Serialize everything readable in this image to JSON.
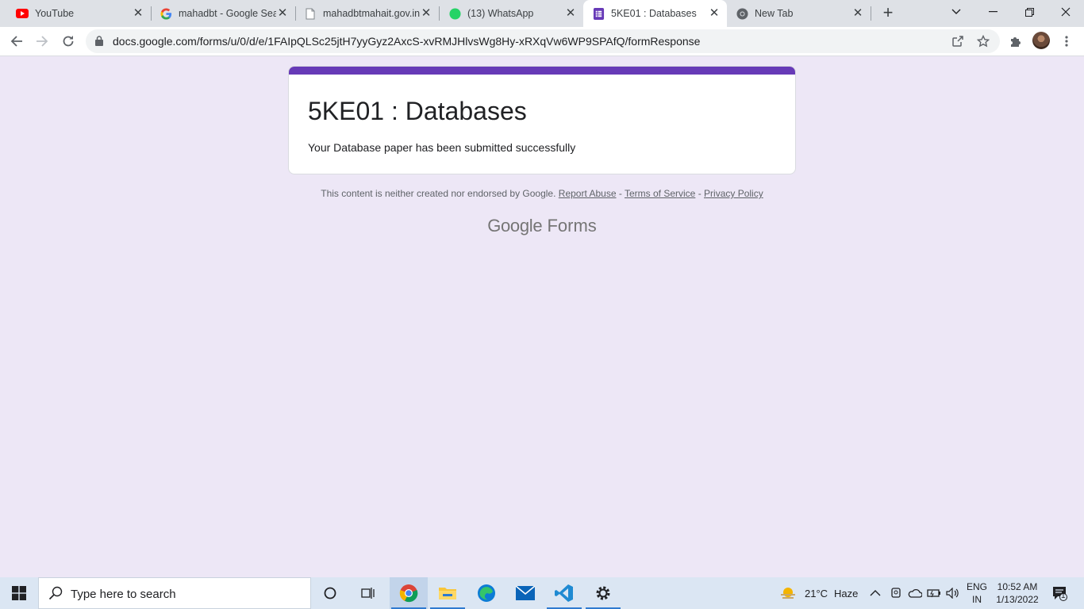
{
  "browser": {
    "tabs": [
      {
        "title": "YouTube",
        "icon": "youtube-icon",
        "active": false
      },
      {
        "title": "mahadbt - Google Sea",
        "icon": "google-icon",
        "active": false
      },
      {
        "title": "mahadbtmahait.gov.in",
        "icon": "document-icon",
        "active": false
      },
      {
        "title": "(13) WhatsApp",
        "icon": "whatsapp-icon",
        "badge": "13",
        "active": false
      },
      {
        "title": "5KE01 : Databases",
        "icon": "google-forms-icon",
        "active": true
      },
      {
        "title": "New Tab",
        "icon": "chrome-icon",
        "active": false
      }
    ],
    "url": "docs.google.com/forms/u/0/d/e/1FAIpQLSc25jtH7yyGyz2AxcS-xvRMJHlvsWg8Hy-xRXqVw6WP9SPAfQ/formResponse"
  },
  "form": {
    "title": "5KE01 : Databases",
    "message": "Your Database paper has been submitted successfully",
    "accent_color": "#673ab7"
  },
  "footer": {
    "disclaimer": "This content is neither created nor endorsed by Google.",
    "report_abuse": "Report Abuse",
    "separator": "-",
    "terms": "Terms of Service",
    "privacy": "Privacy Policy",
    "brand_google": "Google",
    "brand_forms": "Forms"
  },
  "taskbar": {
    "search_placeholder": "Type here to search",
    "weather": {
      "temp": "21°C",
      "condition": "Haze"
    },
    "language": {
      "line1": "ENG",
      "line2": "IN"
    },
    "clock": {
      "time": "10:52 AM",
      "date": "1/13/2022"
    },
    "notifications_count": "1"
  }
}
